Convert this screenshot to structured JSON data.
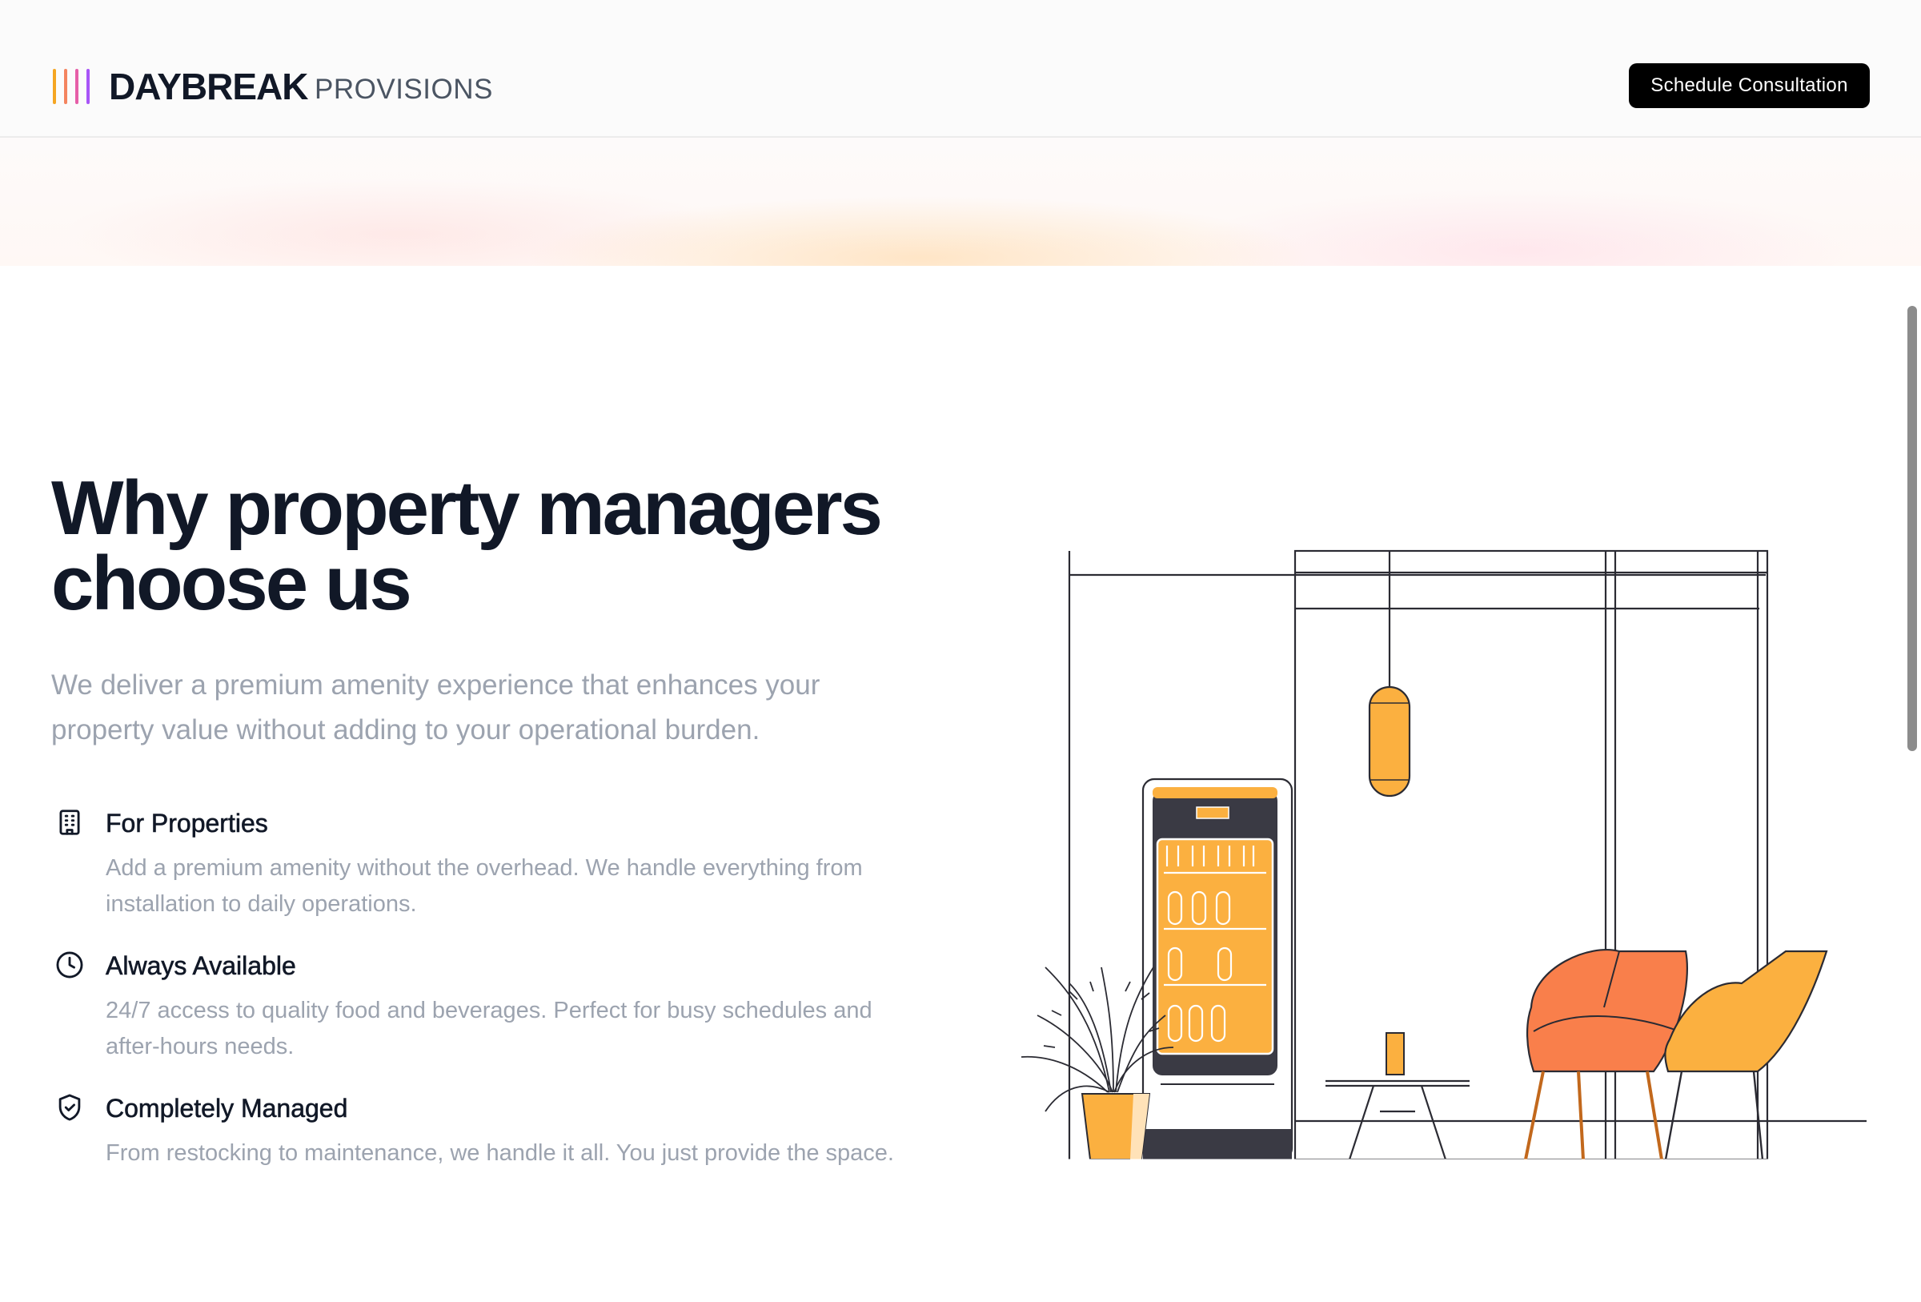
{
  "header": {
    "brand_main": "DAYBREAK",
    "brand_sub": "PROVISIONS",
    "logo_bar_colors": [
      "#f5a623",
      "#f4845f",
      "#e65fa8",
      "#a855f7"
    ],
    "cta_label": "Schedule Consultation"
  },
  "main": {
    "headline_line1": "Why property managers",
    "headline_line2": "choose us",
    "lead": "We deliver a premium amenity experience that enhances your property value without adding to your operational burden.",
    "features": [
      {
        "icon": "building-icon",
        "title": "For Properties",
        "description": "Add a premium amenity without the overhead. We handle everything from installation to daily operations."
      },
      {
        "icon": "clock-icon",
        "title": "Always Available",
        "description": "24/7 access to quality food and beverages. Perfect for busy schedules and after-hours needs."
      },
      {
        "icon": "shield-check-icon",
        "title": "Completely Managed",
        "description": "From restocking to maintenance, we handle it all. You just provide the space."
      }
    ]
  },
  "colors": {
    "accent_orange": "#fbb040",
    "accent_coral": "#f97f4b",
    "text_dark": "#111827",
    "text_muted": "#9ca3af",
    "button_bg": "#000000"
  }
}
